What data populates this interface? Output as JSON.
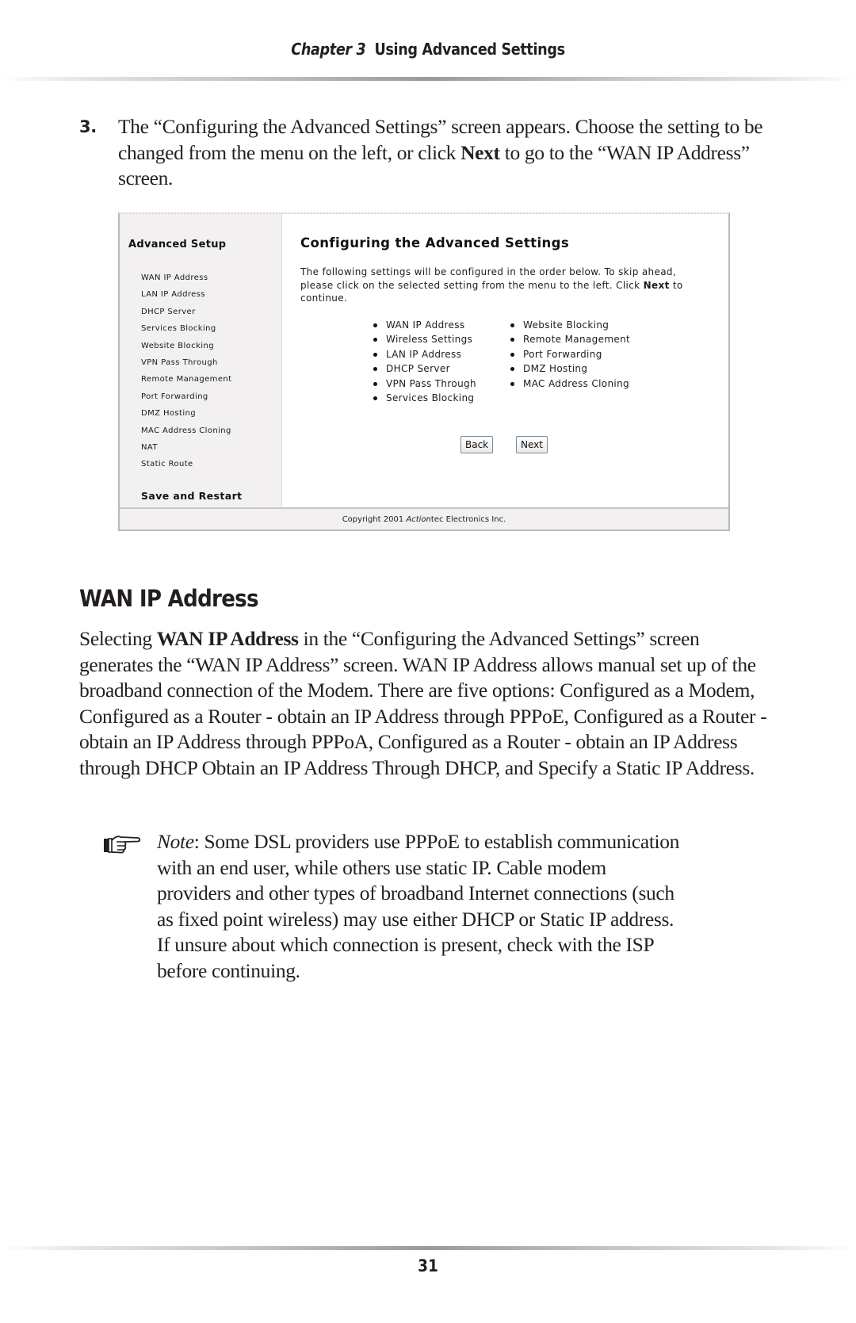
{
  "header": {
    "chapter_label": "Chapter 3",
    "chapter_title": "Using Advanced Settings"
  },
  "step": {
    "number": "3.",
    "text_before_next": "The “Configuring the Advanced Settings” screen appears. Choose the setting to be changed from the menu on the left, or click ",
    "next_bold": "Next",
    "text_after_next": " to go to the “WAN IP Address” screen."
  },
  "screenshot": {
    "sidebar": {
      "title": "Advanced Setup",
      "items": [
        "WAN IP Address",
        "LAN IP Address",
        "DHCP Server",
        "Services Blocking",
        "Website Blocking",
        "VPN Pass Through",
        "Remote Management",
        "Port Forwarding",
        "DMZ Hosting",
        "MAC Address Cloning",
        "NAT",
        "Static Route"
      ],
      "save_restart": "Save and Restart"
    },
    "main": {
      "title": "Configuring the Advanced Settings",
      "desc_before_next": "The following settings will be configured in the order below. To skip ahead, please click on the selected setting from the menu to the left. Click ",
      "desc_next_bold": "Next",
      "desc_after_next": " to continue.",
      "settings_col1": [
        "WAN IP Address",
        "Wireless Settings",
        "LAN IP Address",
        "DHCP Server",
        "VPN Pass Through",
        "Services Blocking"
      ],
      "settings_col2": [
        "Website Blocking",
        "Remote Management",
        "Port Forwarding",
        "DMZ Hosting",
        "MAC Address Cloning"
      ],
      "back_label": "Back",
      "next_label": "Next"
    },
    "footer": {
      "copyright_prefix": "Copyright 2001 ",
      "brand_italic": "Action",
      "brand_rest": "tec Electronics Inc."
    }
  },
  "section": {
    "heading": "WAN IP Address",
    "body_prefix": "Selecting ",
    "body_bold": "WAN IP Address",
    "body_rest": " in the “Configuring the Advanced Settings” screen generates the “WAN IP Address” screen. WAN IP Address allows manual set up of the broadband connection of the Modem. There are five options: Configured as a Modem, Configured as a Router - obtain an IP Address through PPPoE, Configured as a Router - obtain an IP Address through PPPoA, Configured as a Router - obtain an IP Address through DHCP Obtain an IP Address Through DHCP, and Specify a Static IP Address."
  },
  "note": {
    "icon": "pointing-hand-icon",
    "label": "Note",
    "text": ": Some DSL providers use PPPoE to establish communication with an end user, while others use static IP. Cable modem providers and other types of broadband Internet connections (such as fixed point wireless) may use either DHCP or Static IP address. If unsure about which connection is present, check with the ISP before continuing."
  },
  "footer": {
    "page_number": "31"
  }
}
